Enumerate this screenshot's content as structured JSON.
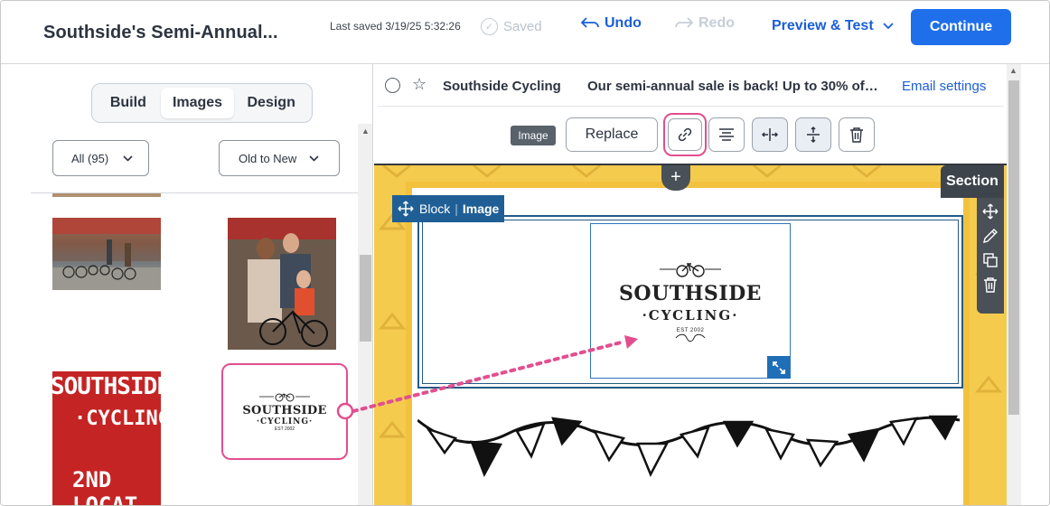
{
  "header": {
    "title": "Southside's Semi-Annual...",
    "last_saved": "Last saved 3/19/25 5:32:26",
    "saved_label": "Saved",
    "undo_label": "Undo",
    "redo_label": "Redo",
    "preview_label": "Preview & Test",
    "continue_label": "Continue"
  },
  "left_panel": {
    "tabs": [
      {
        "label": "Build"
      },
      {
        "label": "Images",
        "selected": true
      },
      {
        "label": "Design"
      }
    ],
    "filter": {
      "value": "All (95)"
    },
    "sort": {
      "value": "Old to New"
    },
    "images": [
      {
        "name": "bike-shop-storefront-photo"
      },
      {
        "name": "family-with-bikes-photo"
      },
      {
        "name": "southside-cycling-2nd-location-sign",
        "text": [
          "SOUTHSIDE",
          "·CYCLING",
          "2ND LOCAT"
        ]
      },
      {
        "name": "southside-cycling-logo",
        "selected": true,
        "text": [
          "SOUTHSIDE",
          "·CYCLING·",
          "EST 2002"
        ]
      }
    ]
  },
  "email_header": {
    "sender": "Southside Cycling",
    "subject": "Our semi-annual sale is back! Up to 30% of…",
    "settings_label": "Email settings"
  },
  "image_toolbar": {
    "tag": "Image",
    "replace_label": "Replace",
    "buttons": [
      "link-icon",
      "align-center-icon",
      "fit-width-icon",
      "fit-height-icon",
      "trash-icon"
    ]
  },
  "canvas": {
    "section_label": "Section",
    "block_label": "Block",
    "block_type": "Image",
    "logo": {
      "line1": "SOUTHSIDE",
      "line2": "·CYCLING·",
      "line3": "EST 2002"
    },
    "section_tools": [
      "move-icon",
      "pencil-icon",
      "duplicate-icon",
      "trash-icon"
    ]
  },
  "colors": {
    "primary": "#1f6feb",
    "link": "#1a5fd6",
    "highlight": "#e14f8f",
    "canvas_bg": "#f5cb4e",
    "block_blue": "#1f5f96"
  }
}
